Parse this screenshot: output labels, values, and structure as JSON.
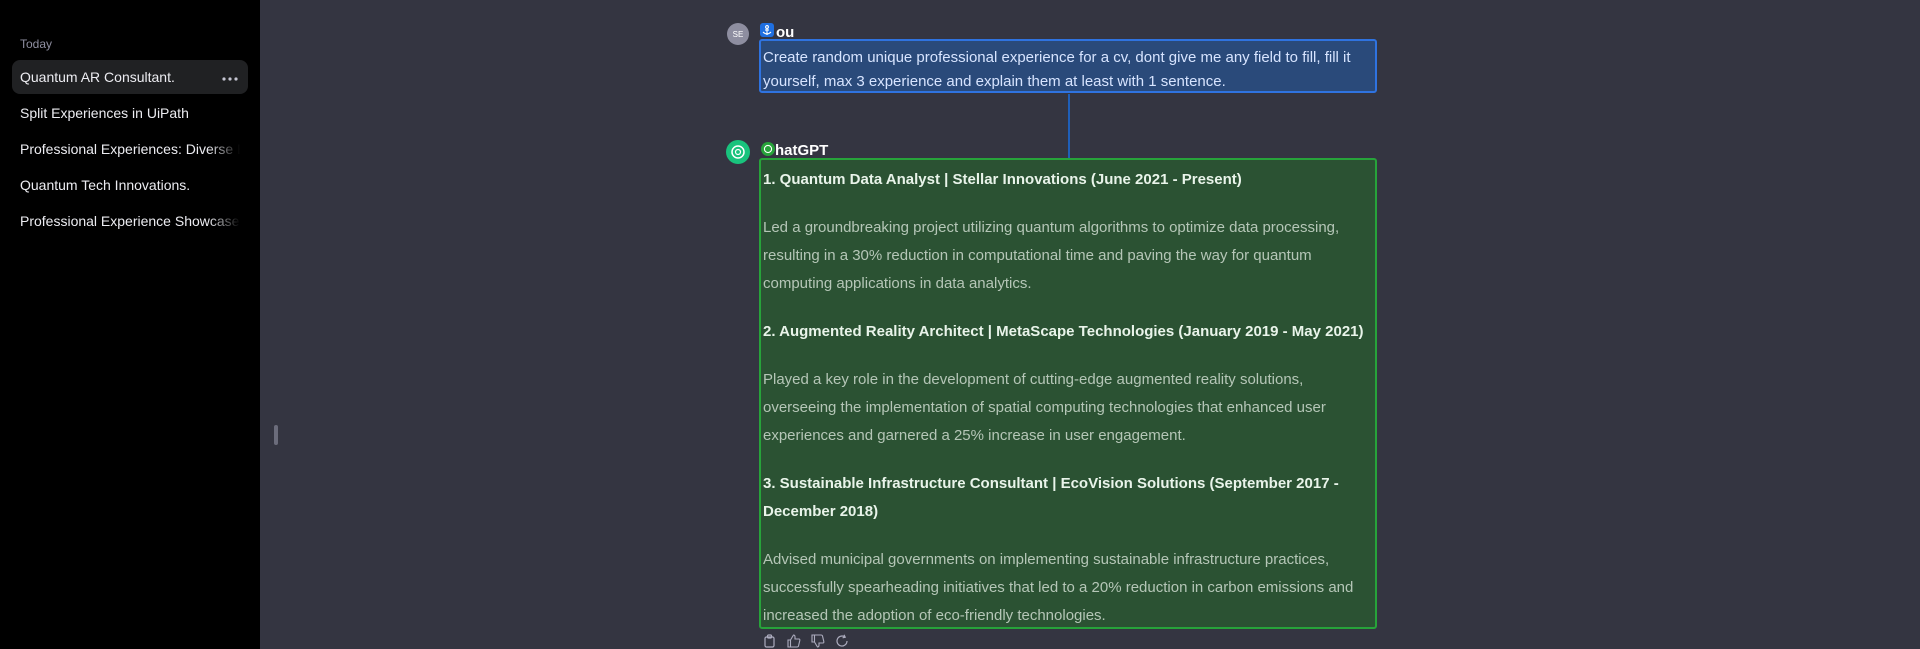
{
  "sidebar": {
    "section_label": "Today",
    "items": [
      {
        "label": "Quantum AR Consultant.",
        "active": true
      },
      {
        "label": "Split Experiences in UiPath",
        "active": false
      },
      {
        "label": "Professional Experiences: Diverse E",
        "active": false
      },
      {
        "label": "Quantum Tech Innovations.",
        "active": false
      },
      {
        "label": "Professional Experience Showcase",
        "active": false
      }
    ],
    "more_icon": "ellipsis-icon"
  },
  "conversation": {
    "user": {
      "avatar_text": "SE",
      "name": "ou",
      "message": "Create random unique professional experience for a cv, dont give me any field to fill, fill it yourself,  max 3 experience and explain them at least with 1 sentence."
    },
    "assistant": {
      "name": "hatGPT",
      "experiences": [
        {
          "heading": "1. Quantum Data Analyst | Stellar Innovations (June 2021 - Present)",
          "description": "Led a groundbreaking project utilizing quantum algorithms to optimize data processing, resulting in a 30% reduction in computational time and paving the way for quantum computing applications in data analytics."
        },
        {
          "heading": "2. Augmented Reality Architect | MetaScape Technologies (January 2019 - May 2021)",
          "description": "Played a key role in the development of cutting-edge augmented reality solutions, overseeing the implementation of spatial computing technologies that enhanced user experiences and garnered a 25% increase in user engagement."
        },
        {
          "heading": "3. Sustainable Infrastructure Consultant | EcoVision Solutions (September 2017 - December 2018)",
          "description": "Advised municipal governments on implementing sustainable infrastructure practices, successfully spearheading initiatives that led to a 20% reduction in carbon emissions and increased the adoption of eco-friendly technologies."
        }
      ]
    }
  },
  "actions": [
    "copy-icon",
    "thumbs-up-icon",
    "thumbs-down-icon",
    "regenerate-icon"
  ],
  "colors": {
    "sidebar_bg": "#000000",
    "main_bg": "#343541",
    "user_highlight": "#2f73e0",
    "assistant_highlight": "#27a33a",
    "gpt_brand": "#19c37d"
  }
}
